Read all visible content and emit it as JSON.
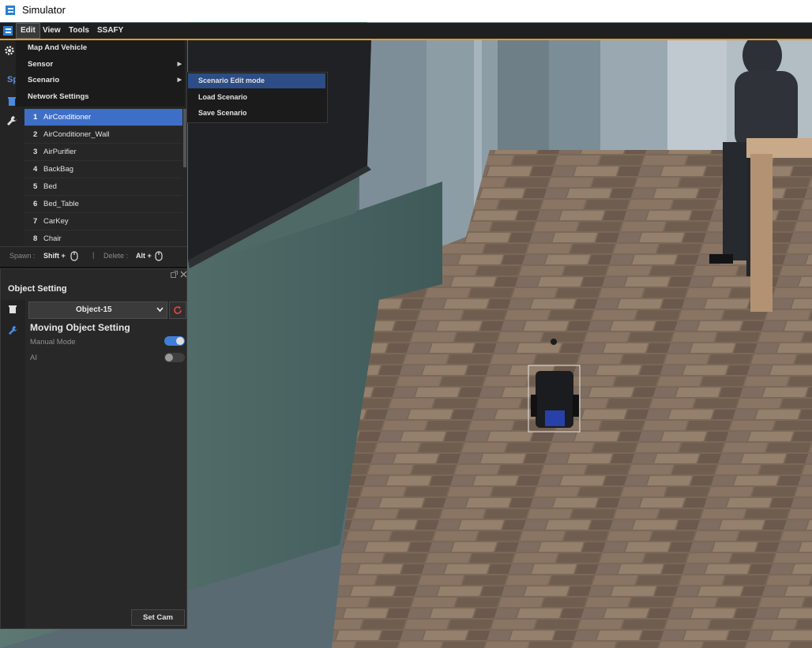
{
  "window": {
    "title": "Simulator"
  },
  "menubar": {
    "items": [
      "Edit",
      "View",
      "Tools",
      "SSAFY"
    ]
  },
  "edit_menu": {
    "items": [
      {
        "label": "Map And Vehicle",
        "submenu": false
      },
      {
        "label": "Sensor",
        "submenu": true
      },
      {
        "label": "Scenario",
        "submenu": true
      },
      {
        "label": "Network Settings",
        "submenu": false
      }
    ],
    "arrow_glyph": "▶"
  },
  "scenario_submenu": {
    "items": [
      "Scenario Edit mode",
      "Load Scenario",
      "Save Scenario"
    ],
    "selected_index": 0
  },
  "spawn_panel": {
    "tab_partial": "Sp",
    "objects": [
      {
        "num": "1",
        "name": "AirConditioner"
      },
      {
        "num": "2",
        "name": "AirConditioner_Wall"
      },
      {
        "num": "3",
        "name": "AirPurifier"
      },
      {
        "num": "4",
        "name": "BackBag"
      },
      {
        "num": "5",
        "name": "Bed"
      },
      {
        "num": "6",
        "name": "Bed_Table"
      },
      {
        "num": "7",
        "name": "CarKey"
      },
      {
        "num": "8",
        "name": "Chair"
      }
    ],
    "selected_index": 0,
    "spawn_label": "Spawn :",
    "spawn_key": "Shift +",
    "delete_label": "Delete :",
    "delete_key": "Alt +"
  },
  "object_setting": {
    "title": "Object Setting",
    "selected_object": "Object-15",
    "section_title": "Moving Object Setting",
    "manual_mode_label": "Manual Mode",
    "manual_mode_on": true,
    "ai_label": "AI",
    "ai_on": false,
    "set_cam_label": "Set Cam"
  },
  "colors": {
    "accent_orange": "#e39a2b",
    "selection_blue": "#3e6fc7",
    "submenu_selection": "#2c4d85",
    "toggle_on": "#3f7fd9"
  }
}
